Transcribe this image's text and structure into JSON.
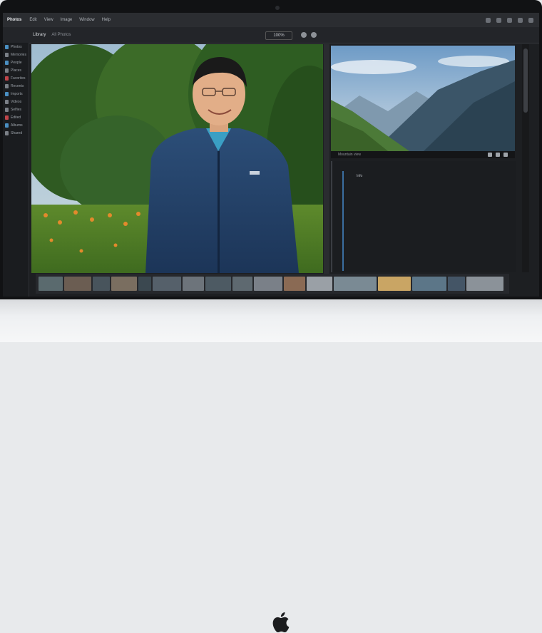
{
  "menubar": {
    "app": "Photos",
    "items": [
      "Edit",
      "View",
      "Image",
      "Window",
      "Help"
    ]
  },
  "toolbar": {
    "crumb": "Library",
    "sub": "All Photos",
    "zoom": "100%"
  },
  "sidebar": {
    "items": [
      "Photos",
      "Memories",
      "People",
      "Places",
      "Favorites",
      "Recents",
      "Imports",
      "Videos",
      "Selfies",
      "Edited",
      "Albums",
      "Shared"
    ]
  },
  "meta": {
    "label": "Mountain view"
  },
  "notes": {
    "lines": [
      "Info",
      "",
      "",
      "",
      "",
      ""
    ]
  },
  "colors": {
    "accent": "#4a8fc2",
    "highlight": "#c0454a"
  }
}
